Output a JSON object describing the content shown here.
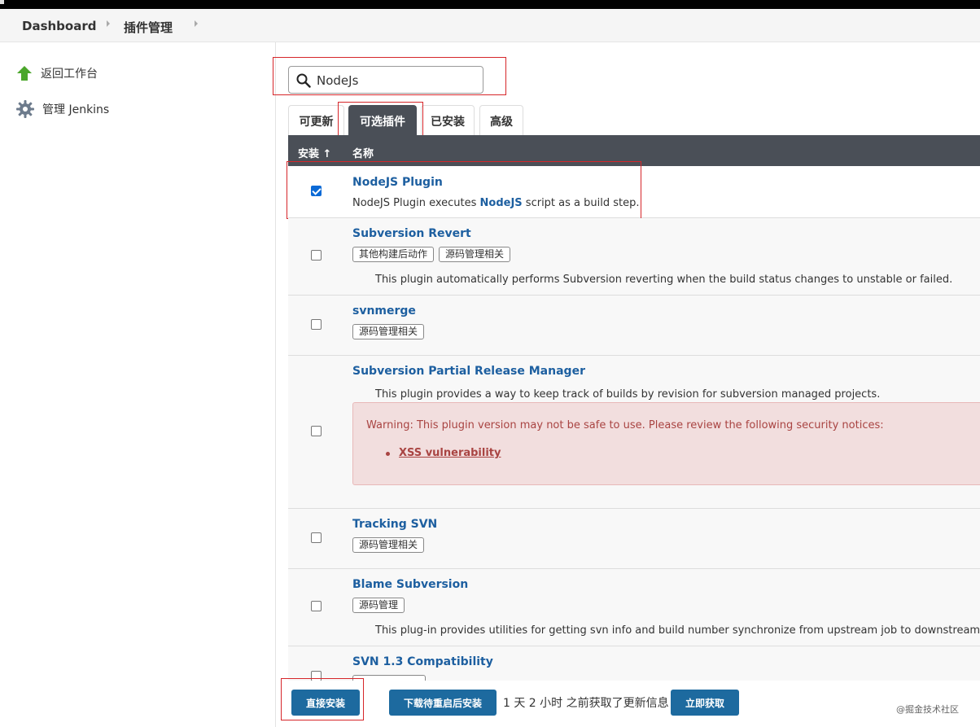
{
  "breadcrumb": {
    "items": [
      "Dashboard",
      "插件管理"
    ]
  },
  "sidebar": {
    "items": [
      {
        "label": "返回工作台",
        "icon": "arrow-up-icon"
      },
      {
        "label": "管理 Jenkins",
        "icon": "gear-icon"
      }
    ]
  },
  "search": {
    "value": "NodeJs",
    "icon": "search-icon"
  },
  "tabs": [
    {
      "label": "可更新",
      "active": false
    },
    {
      "label": "可选插件",
      "active": true
    },
    {
      "label": "已安装",
      "active": false
    },
    {
      "label": "高级",
      "active": false
    }
  ],
  "table": {
    "headers": {
      "install": "安装 ↑",
      "name": "名称"
    },
    "rows": [
      {
        "name": "NodeJS Plugin",
        "checked": true,
        "desc_pre": "NodeJS Plugin executes ",
        "desc_hl": "NodeJS",
        "desc_post": " script as a build step."
      },
      {
        "name": "Subversion Revert",
        "checked": false,
        "tags": [
          "其他构建后动作",
          "源码管理相关"
        ],
        "desc": "This plugin automatically performs Subversion reverting when the build status changes to unstable or failed."
      },
      {
        "name": "svnmerge",
        "checked": false,
        "tags": [
          "源码管理相关"
        ]
      },
      {
        "name": "Subversion Partial Release Manager",
        "checked": false,
        "desc": "This plugin provides a way to keep track of builds by revision for subversion managed projects.",
        "warning": "Warning: This plugin version may not be safe to use. Please review the following security notices:",
        "warning_link": "XSS vulnerability"
      },
      {
        "name": "Tracking SVN",
        "checked": false,
        "tags": [
          "源码管理相关"
        ]
      },
      {
        "name": "Blame Subversion",
        "checked": false,
        "tags": [
          "源码管理"
        ],
        "desc": "This plug-in provides utilities for getting svn info and build number synchronize from upstream job to downstream job"
      },
      {
        "name": "SVN 1.3 Compatibility",
        "checked": false
      }
    ]
  },
  "footer": {
    "install_now": "直接安装",
    "download_restart": "下载待重启后安装",
    "update_info": "1 天 2 小时 之前获取了更新信息",
    "check_now": "立即获取"
  },
  "watermark": "@掘金技术社区",
  "colors": {
    "accent": "#1d6a9f",
    "header": "#4a4f57",
    "warning_bg": "#f2dede",
    "warning_text": "#a94442",
    "highlight_box": "#d6262a"
  }
}
